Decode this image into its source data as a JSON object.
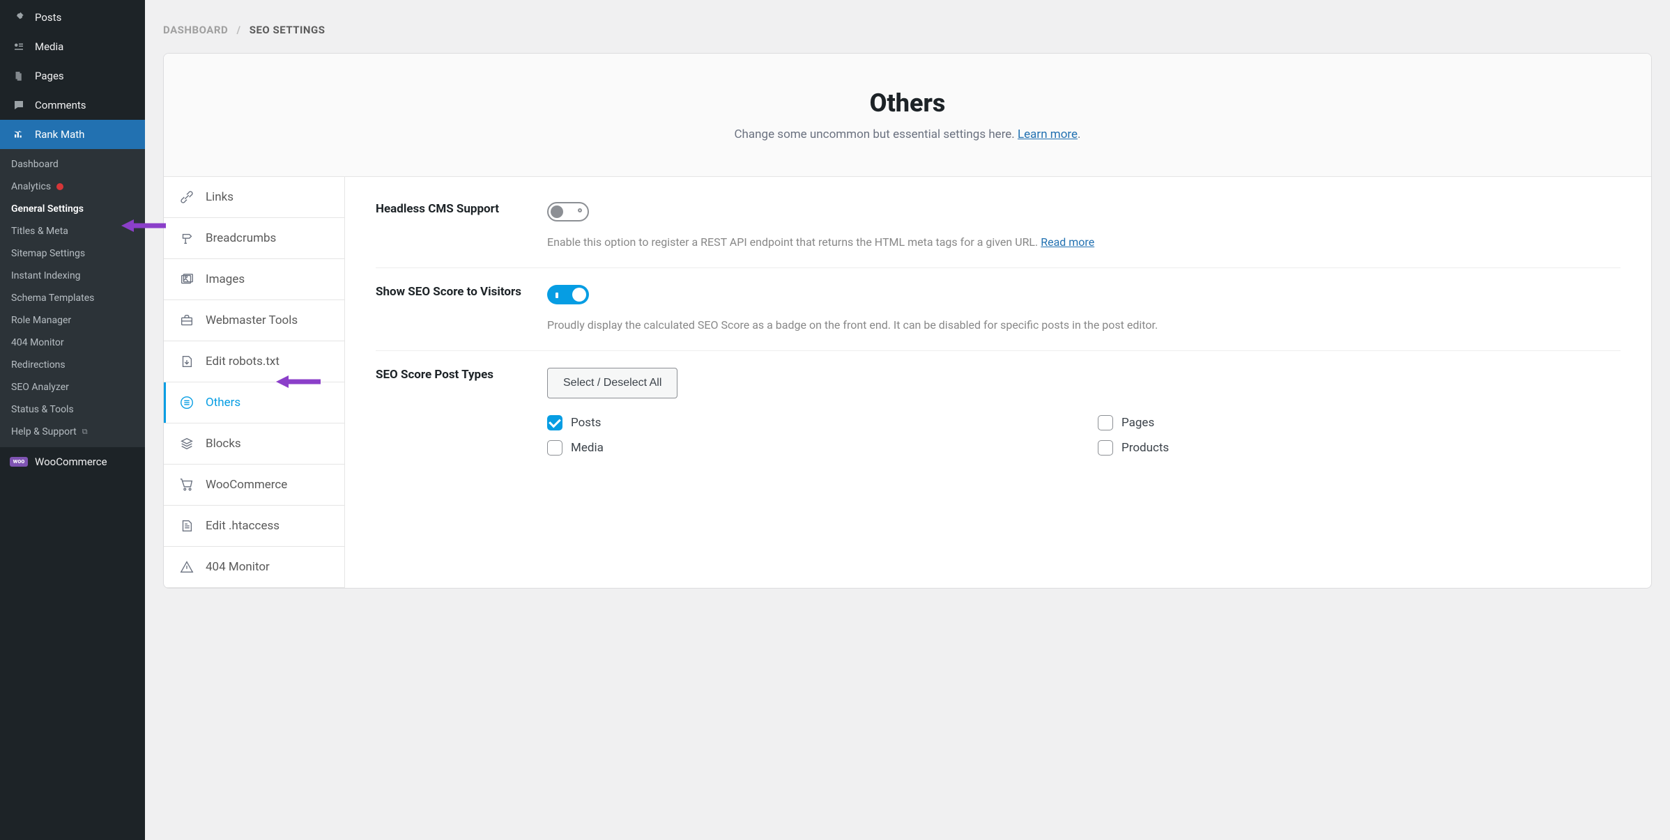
{
  "wp_sidebar": {
    "items": [
      {
        "label": "Posts",
        "icon": "pin"
      },
      {
        "label": "Media",
        "icon": "media"
      },
      {
        "label": "Pages",
        "icon": "pages"
      },
      {
        "label": "Comments",
        "icon": "comments"
      }
    ],
    "active_item": {
      "label": "Rank Math",
      "icon": "chart"
    },
    "submenu": [
      {
        "label": "Dashboard"
      },
      {
        "label": "Analytics",
        "has_dot": true
      },
      {
        "label": "General Settings",
        "current": true
      },
      {
        "label": "Titles & Meta"
      },
      {
        "label": "Sitemap Settings"
      },
      {
        "label": "Instant Indexing"
      },
      {
        "label": "Schema Templates"
      },
      {
        "label": "Role Manager"
      },
      {
        "label": "404 Monitor"
      },
      {
        "label": "Redirections"
      },
      {
        "label": "SEO Analyzer"
      },
      {
        "label": "Status & Tools"
      },
      {
        "label": "Help & Support",
        "external": true
      }
    ],
    "woo_label": "WooCommerce",
    "woo_badge": "woo"
  },
  "breadcrumb": {
    "root": "DASHBOARD",
    "sep": "/",
    "current": "SEO SETTINGS"
  },
  "header": {
    "title": "Others",
    "subtitle_prefix": "Change some uncommon but essential settings here. ",
    "learn_more": "Learn more",
    "subtitle_suffix": "."
  },
  "tabs": [
    {
      "label": "Links",
      "icon": "links"
    },
    {
      "label": "Breadcrumbs",
      "icon": "sign"
    },
    {
      "label": "Images",
      "icon": "images"
    },
    {
      "label": "Webmaster Tools",
      "icon": "briefcase"
    },
    {
      "label": "Edit robots.txt",
      "icon": "file-down"
    },
    {
      "label": "Others",
      "icon": "list-circle",
      "active": true
    },
    {
      "label": "Blocks",
      "icon": "layers"
    },
    {
      "label": "WooCommerce",
      "icon": "cart"
    },
    {
      "label": "Edit .htaccess",
      "icon": "file-lines"
    },
    {
      "label": "404 Monitor",
      "icon": "warning"
    }
  ],
  "settings": {
    "headless": {
      "label": "Headless CMS Support",
      "enabled": false,
      "desc_prefix": "Enable this option to register a REST API endpoint that returns the HTML meta tags for a given URL. ",
      "read_more": "Read more"
    },
    "seo_score": {
      "label": "Show SEO Score to Visitors",
      "enabled": true,
      "desc": "Proudly display the calculated SEO Score as a badge on the front end. It can be disabled for specific posts in the post editor."
    },
    "post_types": {
      "label": "SEO Score Post Types",
      "select_all": "Select / Deselect All",
      "items": [
        {
          "label": "Posts",
          "checked": true
        },
        {
          "label": "Pages",
          "checked": false
        },
        {
          "label": "Media",
          "checked": false
        },
        {
          "label": "Products",
          "checked": false
        }
      ]
    }
  }
}
